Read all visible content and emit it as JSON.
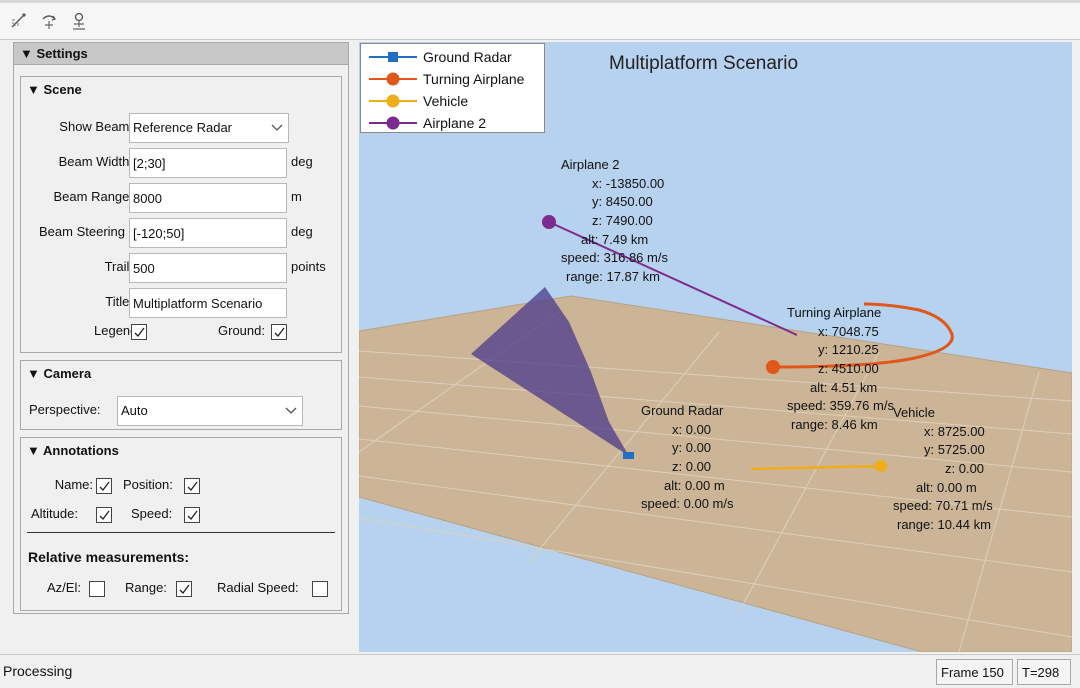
{
  "toolbar": {
    "buttons": [
      {
        "name": "edit-pan-icon"
      },
      {
        "name": "rotate-icon"
      },
      {
        "name": "zoom-icon"
      }
    ]
  },
  "settings": {
    "title": "▼ Settings",
    "scene": {
      "title": "▼ Scene",
      "show_beam_label": "Show Beam:",
      "show_beam_value": "Reference Radar",
      "beam_width_label": "Beam Width:",
      "beam_width_value": "[2;30]",
      "beam_width_unit": "deg",
      "beam_range_label": "Beam Range:",
      "beam_range_value": "8000",
      "beam_range_unit": "m",
      "beam_steering_label": "Beam Steering",
      "beam_steering_value": "[-120;50]",
      "beam_steering_unit": "deg",
      "trail_label": "Trail:",
      "trail_value": "500",
      "trail_unit": "points",
      "title_label": "Title:",
      "title_value": "Multiplatform Scenario",
      "legend_label": "Legend:",
      "legend_checked": true,
      "ground_label": "Ground:",
      "ground_checked": true
    },
    "camera": {
      "title": "▼ Camera",
      "perspective_label": "Perspective:",
      "perspective_value": "Auto"
    },
    "annotations": {
      "title": "▼ Annotations",
      "name_label": "Name:",
      "name_checked": true,
      "position_label": "Position:",
      "position_checked": true,
      "altitude_label": "Altitude:",
      "altitude_checked": true,
      "speed_label": "Speed:",
      "speed_checked": true,
      "relative_title": "Relative measurements:",
      "azel_label": "Az/El:",
      "azel_checked": false,
      "range_label": "Range:",
      "range_checked": true,
      "radial_speed_label": "Radial Speed:",
      "radial_speed_checked": false
    }
  },
  "plot": {
    "title": "Multiplatform Scenario",
    "colors": {
      "sky": "#b6d2ef",
      "ground": "#cbb596",
      "ground_radar": "#1f6fc5",
      "turning_airplane": "#e0561b",
      "vehicle": "#f0ad1a",
      "airplane2": "#7d2a8e",
      "beam": "#4b3a8c"
    },
    "legend": [
      {
        "label": "Ground Radar",
        "marker": "square",
        "color": "#1f6fc5"
      },
      {
        "label": "Turning Airplane",
        "marker": "circle",
        "color": "#e0561b"
      },
      {
        "label": "Vehicle",
        "marker": "circle",
        "color": "#f0ad1a"
      },
      {
        "label": "Airplane 2",
        "marker": "circle",
        "color": "#7d2a8e"
      }
    ],
    "annotations": {
      "airplane2": {
        "name": "Airplane 2",
        "x": "x: -13850.00",
        "y": "y: 8450.00",
        "z": "z: 7490.00",
        "alt": "alt: 7.49 km",
        "speed": "speed: 316.86 m/s",
        "range": "range: 17.87 km"
      },
      "turning_airplane": {
        "name": "Turning Airplane",
        "x": "x: 7048.75",
        "y": "y: 1210.25",
        "z": "z: 4510.00",
        "alt": "alt: 4.51 km",
        "speed": "speed: 359.76 m/s",
        "range": "range: 8.46 km"
      },
      "ground_radar": {
        "name": "Ground Radar",
        "x": "x: 0.00",
        "y": "y: 0.00",
        "z": "z: 0.00",
        "alt": "alt: 0.00 m",
        "speed": "speed: 0.00 m/s"
      },
      "vehicle": {
        "name": "Vehicle",
        "x": "x: 8725.00",
        "y": "y: 5725.00",
        "z": "z: 0.00",
        "alt": "alt: 0.00 m",
        "speed": "speed: 70.71 m/s",
        "range": "range: 10.44 km"
      }
    }
  },
  "status": {
    "text": "Processing",
    "frame": "Frame 150",
    "time": "T=298"
  }
}
